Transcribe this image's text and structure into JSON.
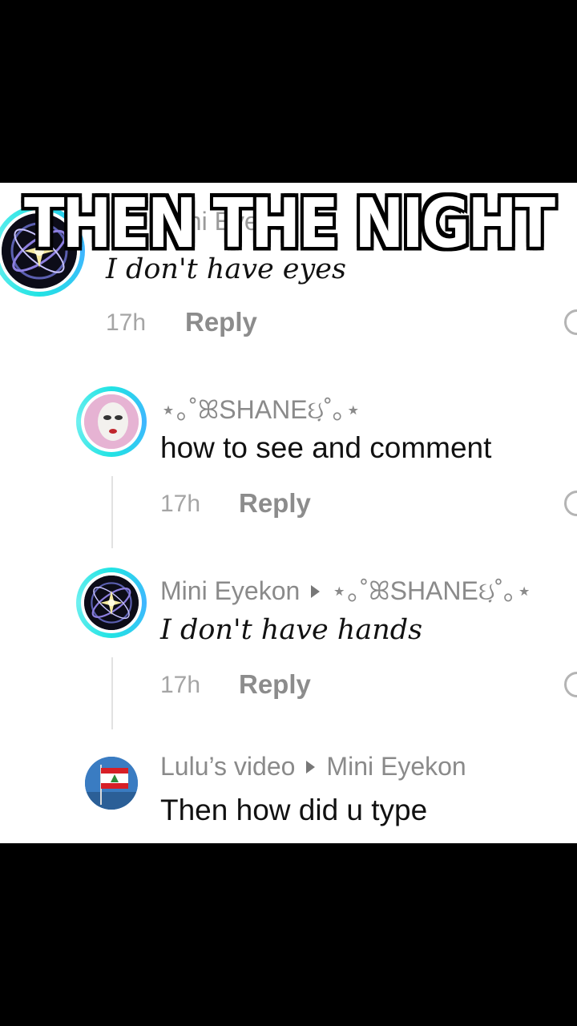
{
  "overlay_caption": "THEN THE NIGHT",
  "comments": [
    {
      "username": "Mini Eyekon",
      "text": "I don't have eyes",
      "time": "17h",
      "reply": "Reply",
      "avatar": "orb-avatar"
    },
    {
      "username": "⋆｡˚ꕤSHANEઇ઼˚｡⋆",
      "text": "how to see and comment",
      "time": "17h",
      "reply": "Reply",
      "avatar": "mask-avatar"
    },
    {
      "username": "Mini Eyekon",
      "reply_to": "⋆｡˚ꕤSHANEઇ઼˚｡⋆",
      "text": "I don't have hands",
      "time": "17h",
      "reply": "Reply",
      "avatar": "orb-avatar"
    },
    {
      "username": "Lulu’s video",
      "reply_to": "Mini Eyekon",
      "text": "Then how did u type",
      "avatar": "flag-avatar"
    }
  ],
  "colors": {
    "story_ring": "#21e3e3",
    "background_frame": "#000000",
    "panel": "#ffffff"
  }
}
